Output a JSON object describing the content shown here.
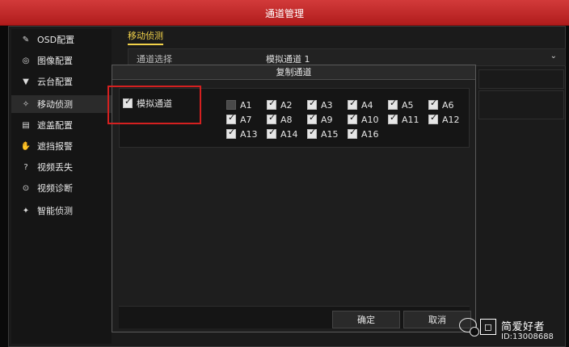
{
  "window": {
    "title": "通道管理"
  },
  "sidebar": {
    "items": [
      {
        "label": "OSD配置",
        "icon": "brush-icon"
      },
      {
        "label": "图像配置",
        "icon": "image-icon"
      },
      {
        "label": "云台配置",
        "icon": "ptz-icon"
      },
      {
        "label": "移动侦测",
        "icon": "motion-icon"
      },
      {
        "label": "遮盖配置",
        "icon": "privacy-mask-icon"
      },
      {
        "label": "遮挡报警",
        "icon": "tamper-alarm-icon"
      },
      {
        "label": "视频丢失",
        "icon": "video-loss-icon"
      },
      {
        "label": "视频诊断",
        "icon": "diagnosis-icon"
      },
      {
        "label": "智能侦测",
        "icon": "smart-detection-icon"
      }
    ],
    "active_index": 3
  },
  "main": {
    "section_tab": "移动侦测",
    "channel_select": {
      "label": "通道选择",
      "value": "模拟通道 1",
      "chevron": "⌄"
    }
  },
  "dialog": {
    "title": "复制通道",
    "analog_label": "模拟通道",
    "analog_checked": true,
    "channels": [
      {
        "label": "A1",
        "checked": false,
        "disabled": true
      },
      {
        "label": "A2",
        "checked": true,
        "disabled": false
      },
      {
        "label": "A3",
        "checked": true,
        "disabled": false
      },
      {
        "label": "A4",
        "checked": true,
        "disabled": false
      },
      {
        "label": "A5",
        "checked": true,
        "disabled": false
      },
      {
        "label": "A6",
        "checked": true,
        "disabled": false
      },
      {
        "label": "A7",
        "checked": true,
        "disabled": false
      },
      {
        "label": "A8",
        "checked": true,
        "disabled": false
      },
      {
        "label": "A9",
        "checked": true,
        "disabled": false
      },
      {
        "label": "A10",
        "checked": true,
        "disabled": false
      },
      {
        "label": "A11",
        "checked": true,
        "disabled": false
      },
      {
        "label": "A12",
        "checked": true,
        "disabled": false
      },
      {
        "label": "A13",
        "checked": true,
        "disabled": false
      },
      {
        "label": "A14",
        "checked": true,
        "disabled": false
      },
      {
        "label": "A15",
        "checked": true,
        "disabled": false
      },
      {
        "label": "A16",
        "checked": true,
        "disabled": false
      }
    ],
    "buttons": {
      "ok": "确定",
      "cancel": "取消"
    }
  },
  "watermark": {
    "name": "简爱好者",
    "id": "ID:13008688"
  },
  "colors": {
    "title_red": "#c52626",
    "highlight_red": "#d52020",
    "accent_yellow": "#f2d24a"
  }
}
